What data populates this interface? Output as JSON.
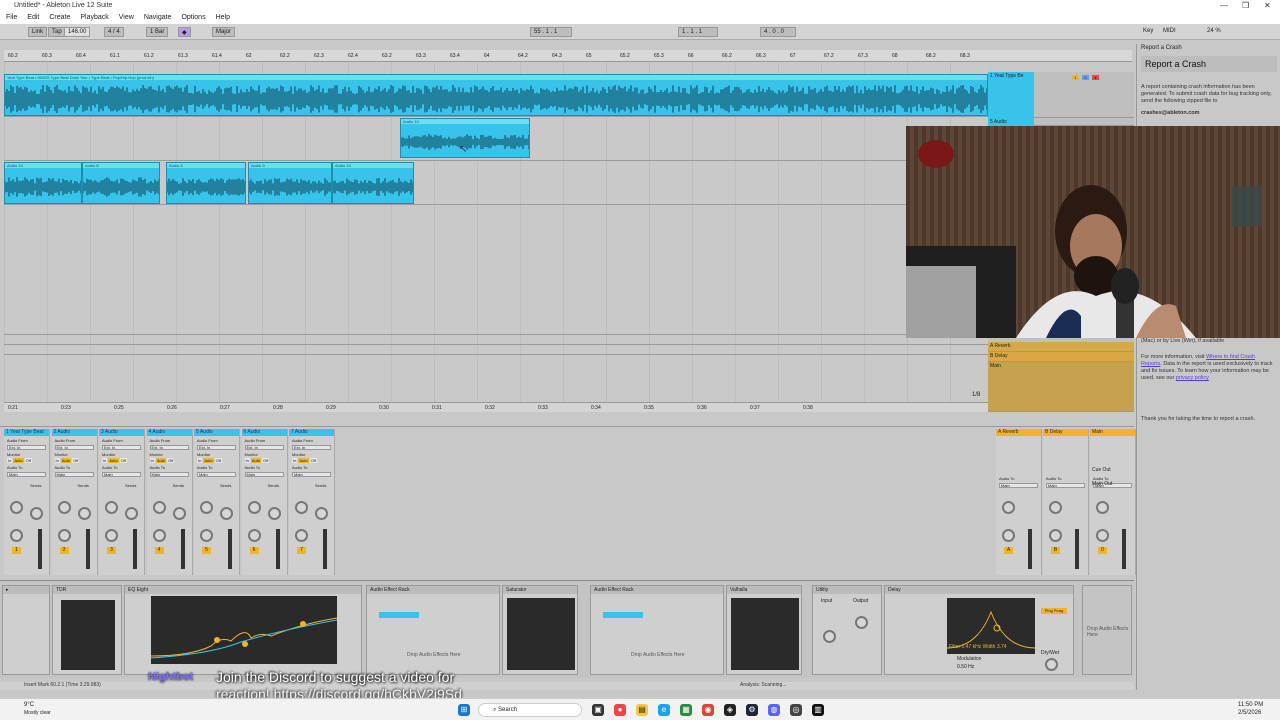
{
  "window": {
    "title": "Untitled* - Ableton Live 12 Suite",
    "controls": [
      "—",
      "❐",
      "✕"
    ]
  },
  "menu": [
    "File",
    "Edit",
    "Create",
    "Playback",
    "View",
    "Navigate",
    "Options",
    "Help"
  ],
  "toolbar": {
    "link": "Link",
    "tap": "Tap",
    "tempo": "146.00",
    "signature": "4 / 4",
    "metro": "1 Bar",
    "key": "Major",
    "position": "55 . 1 . 1",
    "loop_start": "1 . 1 . 1",
    "loop_len": "4 . 0 . 0",
    "key_label": "Key",
    "midi_label": "MIDI",
    "cpu": "24 %"
  },
  "arrangement": {
    "ruler_marks": [
      "60.2",
      "60.3",
      "60.4",
      "61.1",
      "61.2",
      "61.3",
      "61.4",
      "62",
      "62.2",
      "62.3",
      "62.4",
      "63.2",
      "63.3",
      "63.4",
      "64",
      "64.2",
      "64.3",
      "65",
      "65.2",
      "65.3",
      "66",
      "66.2",
      "66.3",
      "67",
      "67.2",
      "67.3",
      "68",
      "68.2",
      "68.3"
    ],
    "clips": [
      {
        "name": "Yeat Type Beat • HMGS Type Beat Dusk Tour • Type Beat • Pop/Hip-Hop (prod.sth)"
      },
      {
        "name": "Audio 10"
      },
      {
        "name": "Audio 10"
      },
      {
        "name": "Audio 8"
      },
      {
        "name": "Audio 8"
      },
      {
        "name": "Audio 9"
      },
      {
        "name": "Audio 10"
      }
    ],
    "time_marks": [
      "0:21",
      "0:23",
      "0:25",
      "0:26",
      "0:27",
      "0:28",
      "0:29",
      "0:30",
      "0:31",
      "0:32",
      "0:33",
      "0:34",
      "0:35",
      "0:36",
      "0:37",
      "0:38"
    ],
    "zoom_label": "1/8"
  },
  "track_heads": [
    {
      "name": "1 Yeat Type Be",
      "color": "#37c3ea"
    },
    {
      "name": "5 Audio",
      "color": "#37c3ea"
    },
    {
      "name": "A Reverb",
      "color": "#f0b429"
    },
    {
      "name": "B Delay",
      "color": "#f0b429"
    },
    {
      "name": "Main",
      "color": "#f0b429"
    }
  ],
  "mixer": {
    "strips": [
      {
        "name": "1 Yeat Type Beat",
        "input": "Ext. In",
        "output": "Main",
        "volume": "1"
      },
      {
        "name": "2 Audio",
        "input": "Ext. In",
        "output": "Main",
        "volume": "2"
      },
      {
        "name": "3 Audio",
        "input": "Ext. In",
        "output": "Main",
        "volume": "3"
      },
      {
        "name": "4 Audio",
        "input": "Ext. In",
        "output": "Main",
        "volume": "4"
      },
      {
        "name": "5 Audio",
        "input": "Ext. In",
        "output": "Main",
        "volume": "5"
      },
      {
        "name": "6 Audio",
        "input": "Ext. In",
        "output": "Main",
        "volume": "6"
      },
      {
        "name": "7 Audio",
        "input": "Ext. In",
        "output": "Main",
        "volume": "7"
      }
    ],
    "returns": [
      {
        "name": "A Reverb",
        "volume": "A"
      },
      {
        "name": "B Delay",
        "volume": "B"
      },
      {
        "name": "Main",
        "volume": "0"
      }
    ],
    "labels": {
      "audio_from": "Audio From",
      "monitor": "Monitor",
      "audio_to": "Audio To",
      "sends": "Sends",
      "auto": "Auto",
      "off": "Off",
      "in": "In",
      "cue_out": "Cue Out",
      "main_out": "Main Out"
    }
  },
  "devices": [
    {
      "name": "EQ Eight"
    },
    {
      "name": "Audio Effect Rack"
    },
    {
      "name": "Saturator"
    },
    {
      "name": "Audio Effect Rack"
    },
    {
      "name": "Valhalla"
    },
    {
      "name": "Utility"
    },
    {
      "name": "Delay"
    }
  ],
  "device_labels": {
    "drop_effects": "Drop Audio Effects Here",
    "utility_input": "Input",
    "utility_output": "Output",
    "delay_filter": "Filter",
    "delay_freq": "1.47 kHz",
    "delay_width": "Width",
    "delay_width_val": "3.74",
    "delay_modulation": "Modulation",
    "delay_rate": "Rate",
    "delay_rate_val": "0.50 Hz",
    "delay_time": "Time",
    "delay_feedback": "Feedback",
    "delay_pingpong": "Ping Pong",
    "delay_drywet": "Dry/Wet"
  },
  "crash_panel": {
    "header": "Report a Crash",
    "title": "Report a Crash",
    "para1": "A report containing crash information has been generated. To submit crash data for bug tracking only, send the following zipped file to",
    "email": "crashes@ableton.com",
    "para2_prefix": "(Mac) or by Live (Win), if available",
    "para3": "For more information, visit",
    "link1": "Where to find Crash Reports",
    "para3b": ". Data in the report is used exclusively to track and fix issues. To learn how your information may be used, see our",
    "link2": "privacy policy",
    "thanks": "Thank you for taking the time to report a crash."
  },
  "status": {
    "text": "Insert Mark 60.2.1 (Time 3:29.983)",
    "right": "Analysis: Scanning..."
  },
  "overlay": {
    "bot": "Nightbot",
    "message": "Join the Discord to suggest a video for",
    "url": "reaction! https://discord.gg/hCkbV2i9Sd"
  },
  "taskbar": {
    "weather_temp": "9°C",
    "weather_desc": "Mostly clear",
    "search": "Search",
    "time": "11:50 PM",
    "date": "2/5/2026"
  },
  "colors": {
    "clip": "#37c3ea",
    "clip_dark": "#1c8fb0",
    "return": "#f0b429",
    "accent_purple": "#7a6cff"
  }
}
